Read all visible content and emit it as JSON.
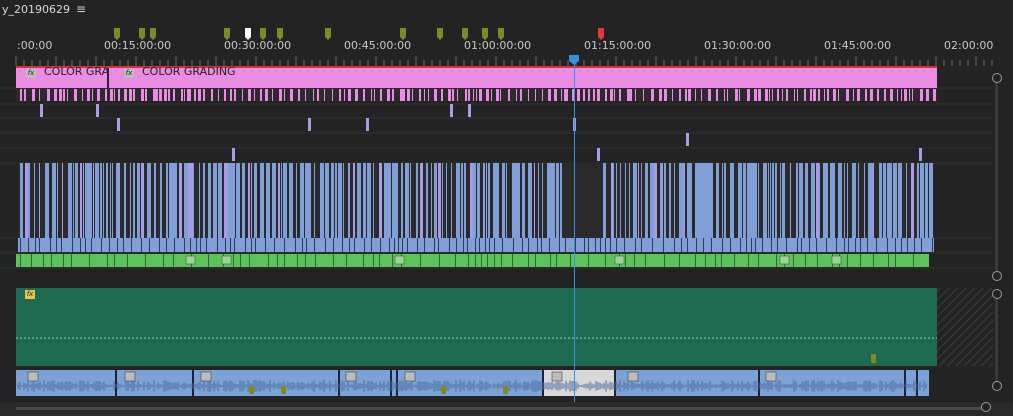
{
  "sequence": {
    "title": "y_20190629",
    "menu_icon": "hamburger-icon"
  },
  "colors": {
    "video_v1": "#ea8be4",
    "video_blue": "#7f9fd6",
    "video_purple": "#a99be6",
    "green_clip": "#5cc35a",
    "audio_bg": "#1e6a50",
    "audio_clip": "#7da3d6",
    "marker_green": "#7c8a2a",
    "marker_white": "#ffffff",
    "marker_red": "#e03a3a",
    "playhead": "#3b8fe0",
    "work_area": "#d4332f"
  },
  "ruler": {
    "timecodes": [
      ":00:00",
      "00:15:00:00",
      "00:30:00:00",
      "00:45:00:00",
      "01:00:00:00",
      "01:15:00:00",
      "01:30:00:00",
      "01:45:00:00",
      "02:00:00"
    ]
  },
  "markers": [
    {
      "color": "green"
    },
    {
      "color": "green"
    },
    {
      "color": "green"
    },
    {
      "color": "green"
    },
    {
      "color": "white"
    },
    {
      "color": "green"
    },
    {
      "color": "green"
    },
    {
      "color": "green"
    },
    {
      "color": "green"
    },
    {
      "color": "green"
    },
    {
      "color": "green"
    },
    {
      "color": "green"
    },
    {
      "color": "green"
    },
    {
      "color": "red"
    }
  ],
  "clips": {
    "color_grading_1": "COLOR GRA",
    "color_grading_2": "COLOR GRADING",
    "fx_label": "fx"
  },
  "icons": {
    "playhead": "playhead-icon",
    "scroll_knob": "scroll-handle-icon",
    "fx": "fx-badge-icon"
  }
}
